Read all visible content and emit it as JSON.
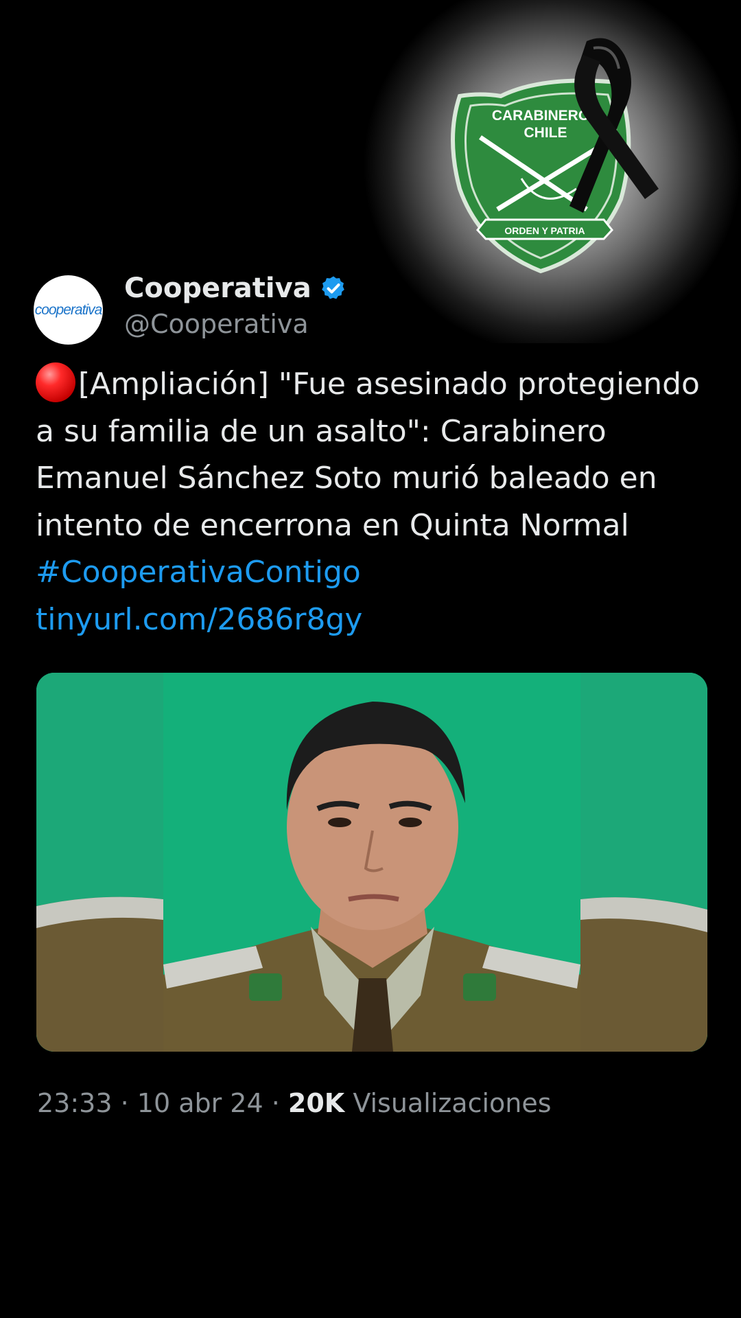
{
  "emblem": {
    "top_text": "CARABINEROS",
    "top_text2": "CHILE",
    "banner_text": "ORDEN Y PATRIA",
    "icon": "carabineros-mourning-emblem"
  },
  "author": {
    "avatar_text": "cooperativa",
    "display_name": "Cooperativa",
    "handle": "@Cooperativa",
    "verified_icon": "verified-badge-icon"
  },
  "tweet": {
    "text_main": "[Ampliación] \"Fue asesinado protegiendo a su familia de un asalto\": Carabinero Emanuel Sánchez Soto murió baleado en intento de encerrona en Quinta Normal ",
    "hashtag": "#CooperativaContigo",
    "url": "tinyurl.com/2686r8gy"
  },
  "meta": {
    "time": "23:33",
    "sep1": " · ",
    "date": "10 abr 24",
    "sep2": " · ",
    "views_count": "20K",
    "views_label": " Visualizaciones"
  },
  "colors": {
    "link": "#1d9bf0",
    "emblem_green": "#2e8b3e",
    "photo_bg": "#14b07a"
  }
}
